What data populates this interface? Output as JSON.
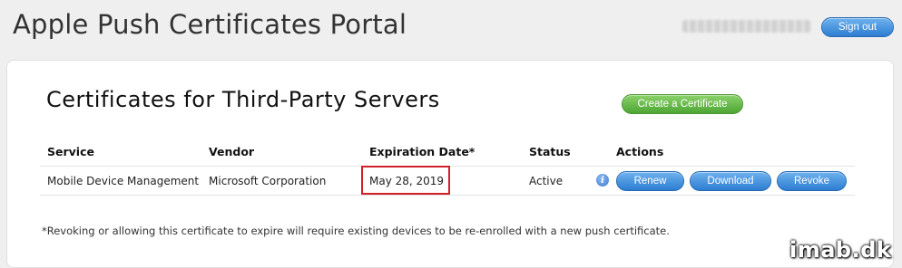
{
  "header": {
    "title": "Apple Push Certificates Portal",
    "sign_out_label": "Sign out"
  },
  "section": {
    "title": "Certificates for Third-Party Servers",
    "create_label": "Create a Certificate"
  },
  "table": {
    "columns": [
      "Service",
      "Vendor",
      "Expiration Date*",
      "Status",
      "Actions"
    ],
    "rows": [
      {
        "service": "Mobile Device Management",
        "vendor": "Microsoft Corporation",
        "expiration": "May 28, 2019",
        "status": "Active",
        "actions": {
          "renew": "Renew",
          "download": "Download",
          "revoke": "Revoke"
        }
      }
    ]
  },
  "footnote": "*Revoking or allowing this certificate to expire will require existing devices to be re-enrolled with a new push certificate.",
  "watermark": "imab.dk",
  "colors": {
    "blue_button": "#2d7dd2",
    "green_button": "#4da634",
    "highlight_border": "#d0202a"
  },
  "icons": {
    "info": "info-icon"
  }
}
